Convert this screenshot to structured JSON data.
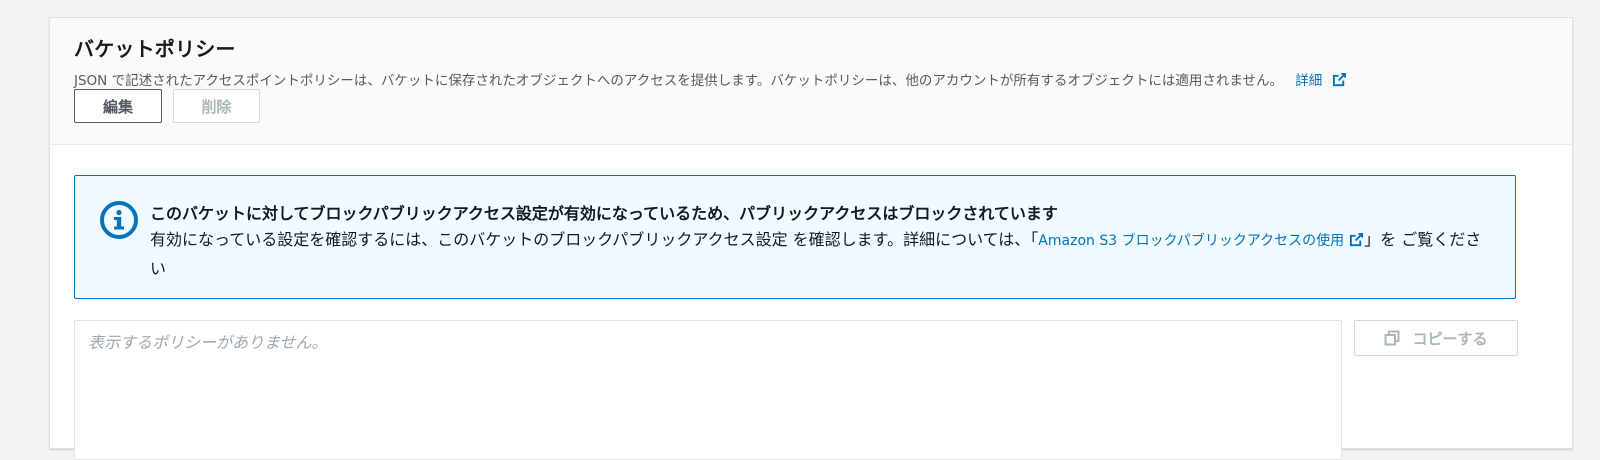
{
  "section": {
    "title": "バケットポリシー",
    "description": "JSON で記述されたアクセスポイントポリシーは、バケットに保存されたオブジェクトへのアクセスを提供します。バケットポリシーは、他のアカウントが所有するオブジェクトには適用されません。",
    "learn_more": "詳細",
    "edit_label": "編集",
    "delete_label": "削除"
  },
  "alert": {
    "title": "このバケットに対してブロックパブリックアクセス設定が有効になっているため、パブリックアクセスはブロックされています",
    "body_prefix": "有効になっている設定を確認するには、このバケットのブロックパブリックアクセス設定 を確認します。詳細については、「",
    "link_text": "Amazon S3 ブロックパブリックアクセスの使用",
    "body_suffix": "」を ご覧ください"
  },
  "policy": {
    "placeholder": "表示するポリシーがありません。",
    "copy_label": "コピーする"
  },
  "colors": {
    "link": "#0073bb",
    "alert_bg": "#f1faff",
    "alert_border": "#0073bb",
    "disabled_text": "#aab7b8"
  }
}
